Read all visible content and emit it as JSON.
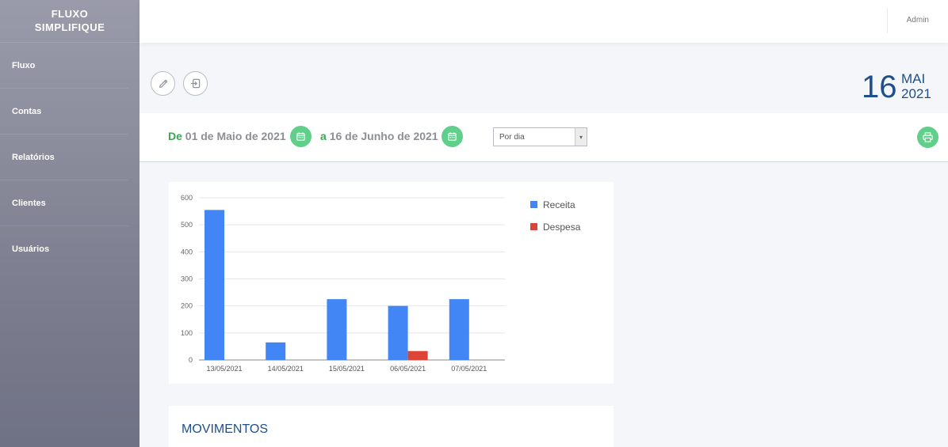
{
  "sidebar": {
    "brand_line1": "FLUXO",
    "brand_line2": "SIMPLIFIQUE",
    "items": [
      {
        "label": "Fluxo"
      },
      {
        "label": "Contas"
      },
      {
        "label": "Relatórios"
      },
      {
        "label": "Clientes"
      },
      {
        "label": "Usuários"
      }
    ]
  },
  "header": {
    "user": "Admin"
  },
  "toolbar": {
    "edit_icon": "pencil-icon",
    "exit_icon": "sign-out-icon"
  },
  "date": {
    "day": "16",
    "month": "MAI",
    "year": "2021"
  },
  "filters": {
    "from_keyword": "De",
    "from_date": "01 de Maio de 2021",
    "to_keyword": "a",
    "to_date": "16 de Junho de 2021",
    "period_selected": "Por dia",
    "calendar_icon": "calendar-icon",
    "print_icon": "printer-icon"
  },
  "colors": {
    "accent_green": "#5fcf8a",
    "title_blue": "#1e4f8c",
    "receita": "#4285f4",
    "despesa": "#db4437"
  },
  "chart_data": {
    "type": "bar",
    "categories": [
      "13/05/2021",
      "14/05/2021",
      "15/05/2021",
      "06/05/2021",
      "07/05/2021"
    ],
    "series": [
      {
        "name": "Receita",
        "values": [
          555,
          65,
          225,
          200,
          225
        ]
      },
      {
        "name": "Despesa",
        "values": [
          0,
          0,
          0,
          33,
          0
        ]
      }
    ],
    "yticks": [
      0,
      100,
      200,
      300,
      400,
      500,
      600
    ],
    "ylim": [
      0,
      600
    ],
    "grid": true,
    "legend": "right"
  },
  "movimentos": {
    "title": "MOVIMENTOS"
  }
}
